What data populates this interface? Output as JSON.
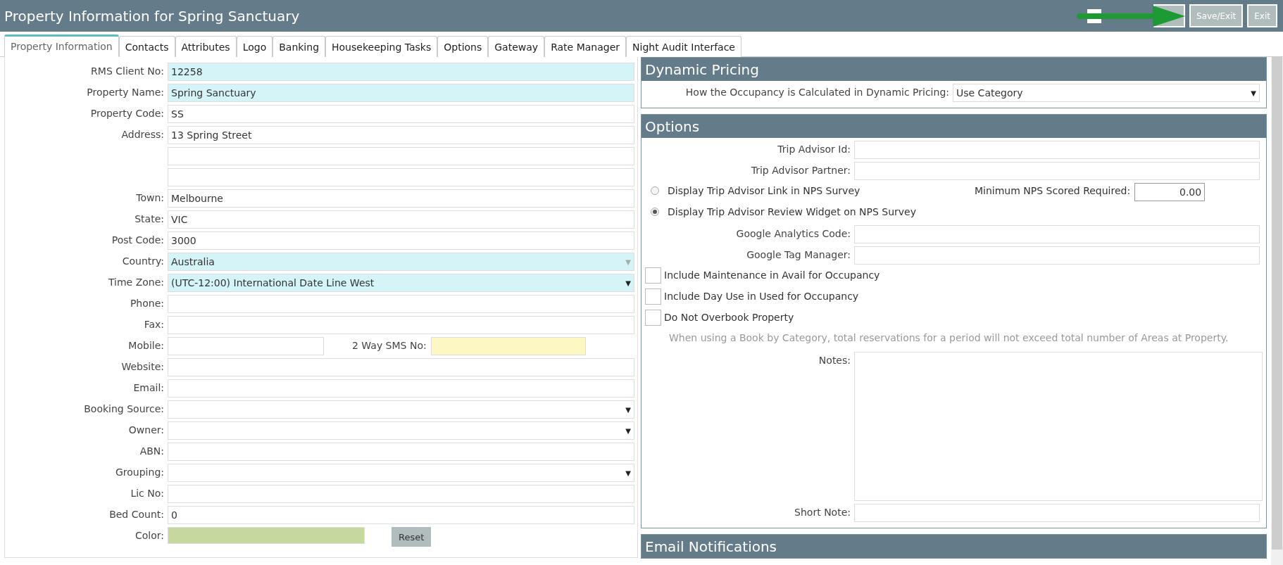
{
  "window": {
    "title": "Property Information for Spring Sanctuary"
  },
  "toolbar": {
    "inactive_checked": false,
    "buttons": [
      {
        "kind": "covered"
      },
      {
        "kind": "text",
        "label": "Save/Exit"
      },
      {
        "kind": "text",
        "label": "Exit"
      }
    ]
  },
  "tabs": [
    {
      "label": "Property Information",
      "selected": true
    },
    {
      "label": "Contacts",
      "selected": false
    },
    {
      "label": "Attributes",
      "selected": false
    },
    {
      "label": "Logo",
      "selected": false
    },
    {
      "label": "Banking",
      "selected": false
    },
    {
      "label": "Housekeeping Tasks",
      "selected": false
    },
    {
      "label": "Options",
      "selected": false
    },
    {
      "label": "Gateway",
      "selected": false
    },
    {
      "label": "Rate Manager",
      "selected": false
    },
    {
      "label": "Night Audit Interface",
      "selected": false
    }
  ],
  "property_fields": [
    {
      "kind": "text",
      "label": "RMS Client No:",
      "value": "12258",
      "locked": true
    },
    {
      "kind": "text",
      "label": "Property Name:",
      "value": "Spring Sanctuary",
      "locked": true
    },
    {
      "kind": "text",
      "label": "Property Code:",
      "value": "SS",
      "locked": false
    },
    {
      "kind": "text",
      "label": "Address:",
      "value": "13 Spring Street",
      "locked": false
    },
    {
      "kind": "text",
      "locked": false
    },
    {
      "kind": "text",
      "locked": false
    },
    {
      "kind": "text",
      "label": "Town:",
      "value": "Melbourne",
      "locked": false
    },
    {
      "kind": "text",
      "label": "State:",
      "value": "VIC",
      "locked": false
    },
    {
      "kind": "text",
      "label": "Post Code:",
      "value": "3000",
      "locked": false
    },
    {
      "kind": "select",
      "label": "Country:",
      "value": "Australia",
      "locked": true,
      "disabled": true,
      "caret": "▼"
    },
    {
      "kind": "select",
      "label": "Time Zone:",
      "value": "(UTC-12:00) International Date Line West",
      "locked": true,
      "disabled": false,
      "caret": "▼"
    },
    {
      "kind": "text",
      "label": "Phone:",
      "locked": false
    },
    {
      "kind": "text",
      "label": "Fax:",
      "locked": false
    },
    {
      "kind": "pair",
      "label": "Mobile:",
      "second_label": "2 Way SMS No:",
      "locked": false
    },
    {
      "kind": "text",
      "label": "Website:",
      "locked": false
    },
    {
      "kind": "text",
      "label": "Email:",
      "locked": false
    },
    {
      "kind": "select",
      "label": "Booking Source:",
      "locked": false,
      "disabled": false,
      "caret": "▼"
    },
    {
      "kind": "select",
      "label": "Owner:",
      "locked": false,
      "disabled": false,
      "caret": "▼"
    },
    {
      "kind": "text",
      "label": "ABN:",
      "locked": false
    },
    {
      "kind": "select",
      "label": "Grouping:",
      "locked": false,
      "disabled": false,
      "caret": "▼"
    },
    {
      "kind": "text",
      "label": "Lic No:",
      "locked": false
    },
    {
      "kind": "text",
      "label": "Bed Count:",
      "value": "0",
      "locked": false
    },
    {
      "kind": "color",
      "label": "Color:",
      "color": "#c5d89d",
      "button": "Reset"
    }
  ],
  "dynamic_pricing": {
    "title": "Dynamic Pricing",
    "label": "How the Occupancy is Calculated in Dynamic Pricing:",
    "value": "Use Category",
    "caret": "▼"
  },
  "options": {
    "title": "Options",
    "rows": [
      {
        "kind": "text",
        "label": "Trip Advisor Id:"
      },
      {
        "kind": "text",
        "label": "Trip Advisor Partner:"
      },
      {
        "kind": "radio",
        "label": "Display Trip Advisor Link in NPS Survey",
        "selected": false,
        "side_label": "Minimum NPS Scored Required:",
        "side_value": "0.00"
      },
      {
        "kind": "radio",
        "label": "Display Trip Advisor Review Widget on NPS Survey",
        "selected": true
      },
      {
        "kind": "text",
        "label": "Google Analytics Code:"
      },
      {
        "kind": "text",
        "label": "Google Tag Manager:"
      },
      {
        "kind": "checkbox",
        "label": "Include Maintenance in Avail for Occupancy",
        "checked": false
      },
      {
        "kind": "checkbox",
        "label": "Include Day Use in Used for Occupancy",
        "checked": false
      },
      {
        "kind": "checkbox",
        "label": "Do Not Overbook Property",
        "checked": false
      },
      {
        "kind": "note",
        "label": "When using a Book by Category, total reservations for a period will not exceed total number of Areas at Property."
      },
      {
        "kind": "textarea",
        "label": "Notes:"
      },
      {
        "kind": "text",
        "label": "Short Note:"
      }
    ]
  },
  "email_notifications": {
    "title": "Email Notifications"
  }
}
